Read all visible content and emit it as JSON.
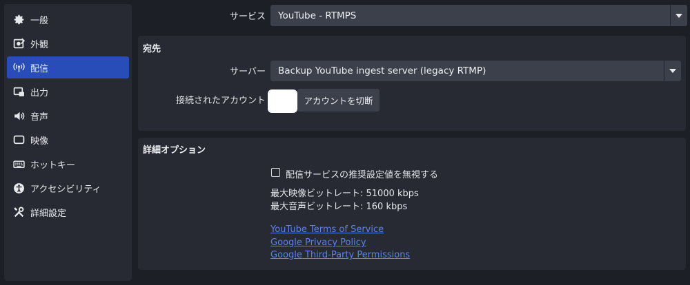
{
  "sidebar": {
    "items": [
      {
        "label": "一般",
        "icon": "gear-icon"
      },
      {
        "label": "外観",
        "icon": "appearance-icon"
      },
      {
        "label": "配信",
        "icon": "broadcast-icon",
        "active": true
      },
      {
        "label": "出力",
        "icon": "output-icon"
      },
      {
        "label": "音声",
        "icon": "speaker-icon"
      },
      {
        "label": "映像",
        "icon": "monitor-icon"
      },
      {
        "label": "ホットキー",
        "icon": "keyboard-icon"
      },
      {
        "label": "アクセシビリティ",
        "icon": "accessibility-icon"
      },
      {
        "label": "詳細設定",
        "icon": "tools-icon"
      }
    ]
  },
  "service": {
    "label": "サービス",
    "value": "YouTube - RTMPS"
  },
  "destination": {
    "title": "宛先",
    "server_label": "サーバー",
    "server_value": "Backup YouTube ingest server (legacy RTMP)",
    "account_label": "接続されたアカウント",
    "switch_account_button": "アカウントを切断"
  },
  "advanced": {
    "title": "詳細オプション",
    "ignore_settings_label": "配信サービスの推奨設定値を無視する",
    "ignore_settings_checked": false,
    "max_video_bitrate": "最大映像ビットレート: 51000 kbps",
    "max_audio_bitrate": "最大音声ビットレート: 160 kbps",
    "links": [
      "YouTube Terms of Service",
      "Google Privacy Policy",
      "Google Third-Party Permissions"
    ]
  },
  "colors": {
    "accent": "#284cb8",
    "link": "#5b82ee",
    "background": "#1d1f26",
    "panel": "#272a33"
  }
}
